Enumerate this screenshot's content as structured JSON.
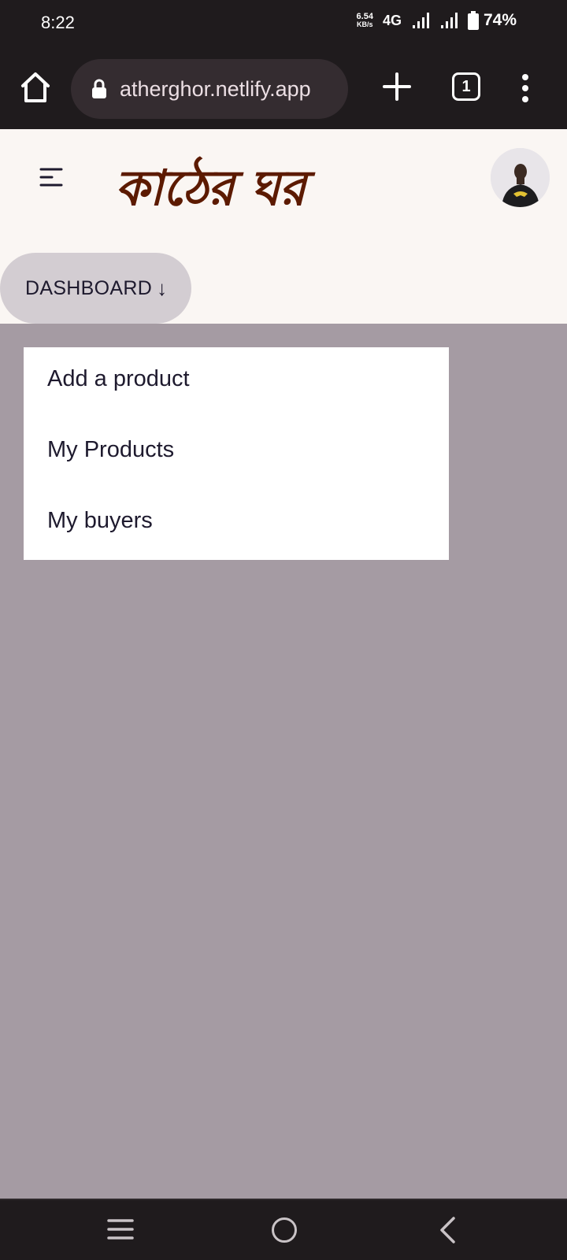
{
  "status_bar": {
    "time": "8:22",
    "net_speed_value": "6.54",
    "net_speed_unit": "KB/s",
    "network_type": "4G",
    "battery": "74%"
  },
  "browser": {
    "url": "atherghor.netlify.app",
    "tab_count": "1"
  },
  "site": {
    "logo_text": "কাঠের ঘর",
    "dashboard_label": "DASHBOARD",
    "dashboard_arrow": "↓"
  },
  "dropdown": {
    "items": [
      {
        "label": "Add a product"
      },
      {
        "label": "My Products"
      },
      {
        "label": "My buyers"
      }
    ]
  },
  "colors": {
    "logo": "#5c1a00",
    "overlay": "#a59ba3",
    "header_bg": "#faf6f3",
    "dashboard_btn": "#d3cdd2"
  },
  "icons": [
    "home-icon",
    "lock-icon",
    "plus-icon",
    "tabs-icon",
    "more-vert-icon",
    "menu-icon",
    "avatar",
    "recent-apps-icon",
    "home-circle-icon",
    "back-icon"
  ]
}
